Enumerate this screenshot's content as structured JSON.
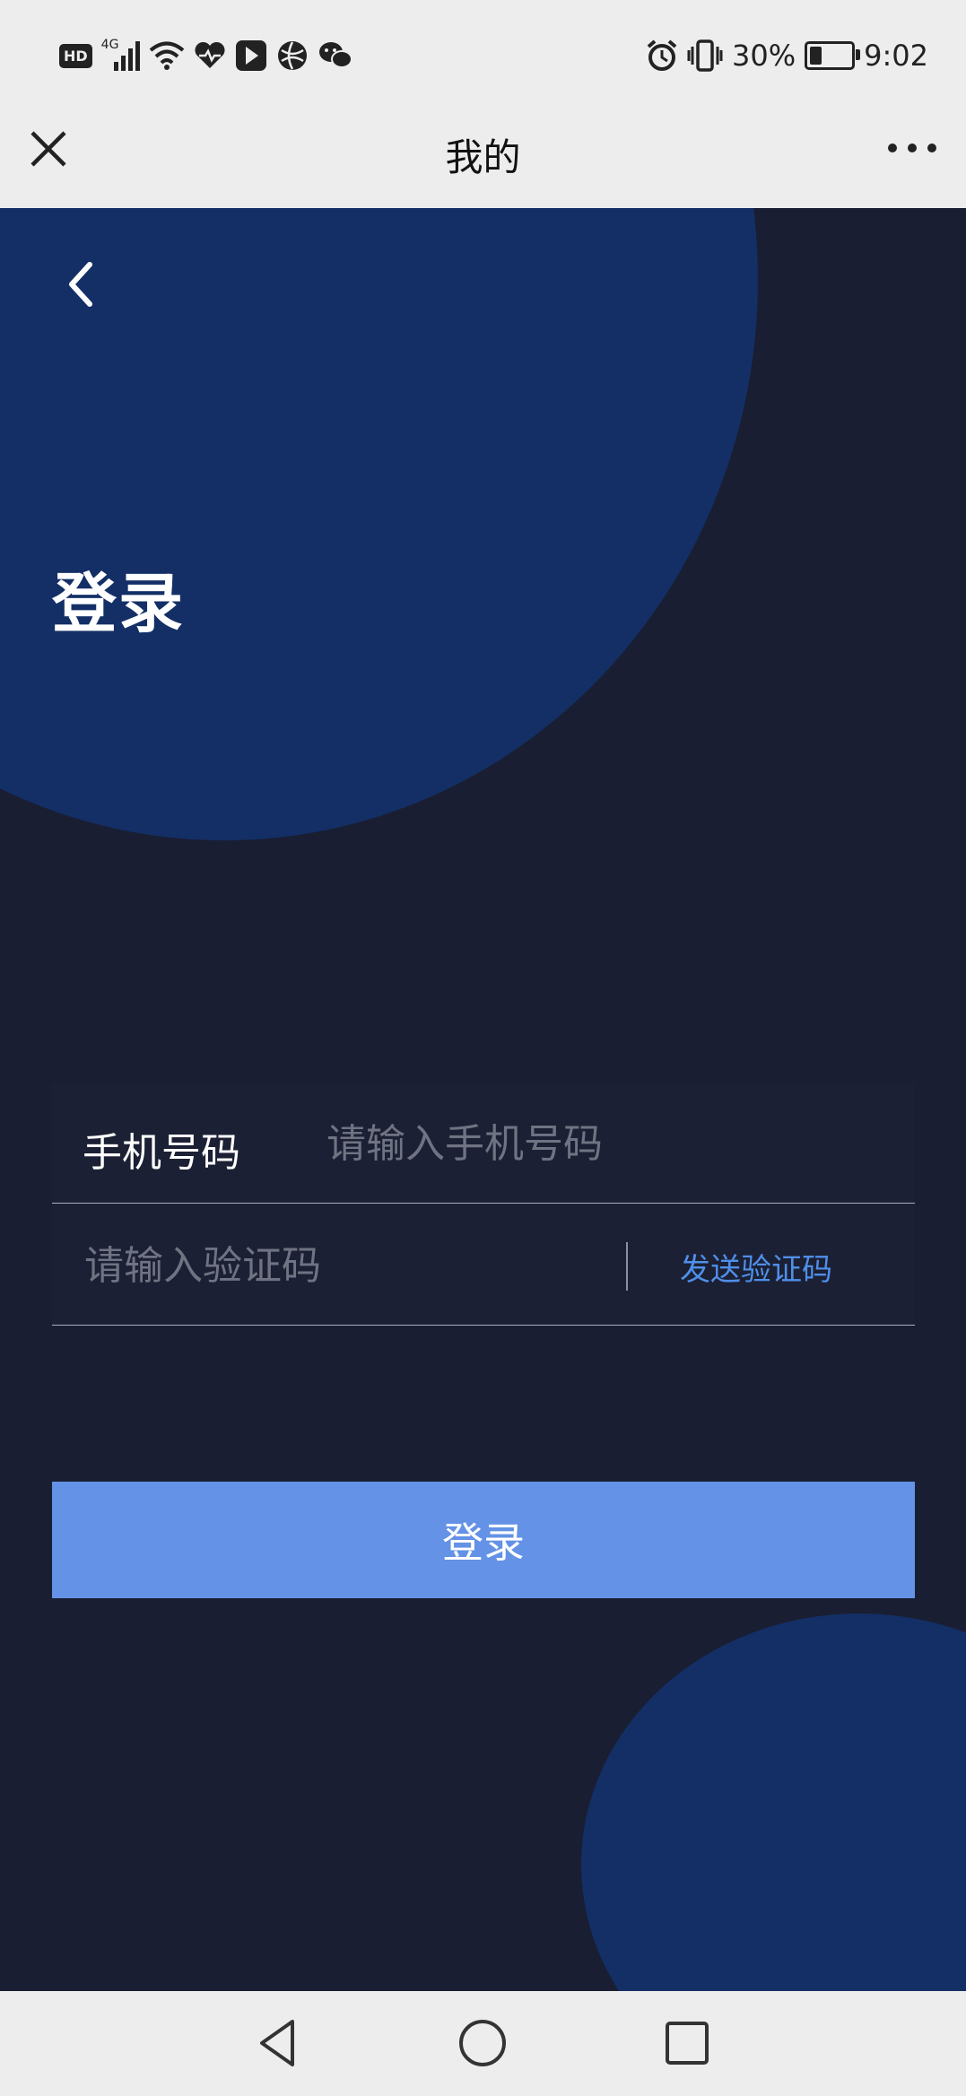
{
  "status_bar": {
    "left_icons": [
      "hd-icon",
      "signal-4g-icon",
      "wifi-icon",
      "health-icon",
      "app-icon",
      "browser-icon",
      "wechat-icon"
    ],
    "network_badge": "HD",
    "network_type": "4G",
    "right_icons": [
      "alarm-icon",
      "vibrate-icon"
    ],
    "battery_percent": "30%",
    "battery_level": 0.3,
    "time": "9:02"
  },
  "title_bar": {
    "title": "我的"
  },
  "page": {
    "heading": "登录",
    "phone_label": "手机号码",
    "phone_placeholder": "请输入手机号码",
    "code_placeholder": "请输入验证码",
    "send_code_label": "发送验证码",
    "login_button_label": "登录"
  },
  "colors": {
    "background": "#191e32",
    "blob": "#142f66",
    "accent_button": "#6392e6",
    "link": "#4f8fe9"
  },
  "nav_bar": {
    "buttons": [
      "back-triangle-icon",
      "home-circle-icon",
      "recent-square-icon"
    ]
  }
}
